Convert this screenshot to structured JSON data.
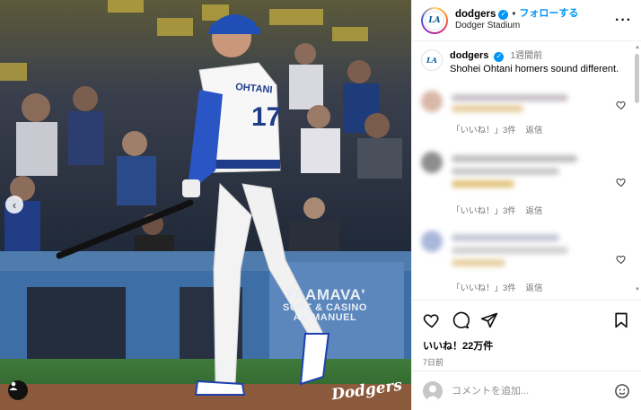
{
  "photo": {
    "jersey_name": "OHTANI",
    "jersey_number": "17",
    "sign_line1": "YAAMAVA'",
    "sign_line2": "SORT & CASINO",
    "sign_line3": "AN MANUEL",
    "corner_logo": "Dodgers",
    "nav_prev_icon": "chevron-left-icon",
    "tag_icon": "user-tag-icon"
  },
  "header": {
    "username": "dodgers",
    "separator": "•",
    "follow_label": "フォローする",
    "location": "Dodger Stadium",
    "more_icon": "more-horizontal-icon"
  },
  "caption": {
    "username": "dodgers",
    "time": "1週間前",
    "text": "Shohei Ohtani homers sound different."
  },
  "comments": [
    {
      "likes_label": "「いいね！」3件",
      "reply_label": "返信"
    },
    {
      "likes_label": "「いいね！」3件",
      "reply_label": "返信"
    },
    {
      "likes_label": "「いいね！」3件",
      "reply_label": "返信"
    }
  ],
  "actions": {
    "likes": "いいね！22万件",
    "date": "7日前"
  },
  "add_comment": {
    "placeholder": "コメントを追加...",
    "emoji_icon": "emoji-smile-icon"
  },
  "colors": {
    "accent": "#0095f6",
    "dodger_blue": "#005a9c"
  }
}
